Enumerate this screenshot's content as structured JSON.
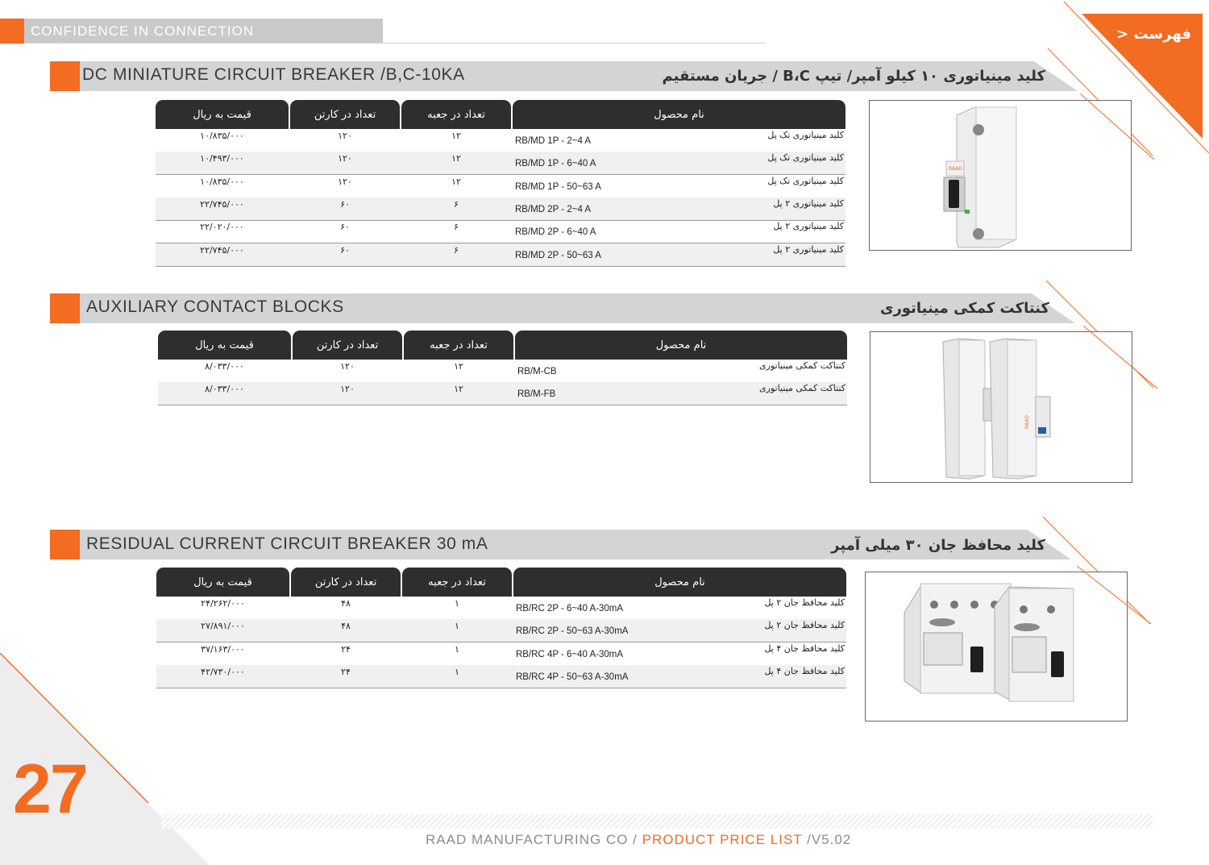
{
  "brand": {
    "tagline": "CONFIDENCE IN CONNECTION"
  },
  "menu": {
    "label": "فهرست <"
  },
  "colors": {
    "accent": "#f26c22",
    "header_dark": "#2e2e30",
    "bar_grey": "#d3d4d5"
  },
  "sections": [
    {
      "title_en": "DC MINIATURE CIRCUIT BREAKER /B,C-10KA",
      "title_fa": "کلید مینیاتوری ۱۰ کیلو آمپر/ تیپ B،C / جریان مستقیم",
      "headers": {
        "name": "نام محصول",
        "per_box": "تعداد در جعبه",
        "per_carton": "تعداد در کارتن",
        "price": "قیمت به ریال"
      },
      "rows": [
        {
          "name": "کلید مینیاتوری تک پل",
          "model": "RB/MD 1P - 2~4 A",
          "per_box": "۱۲",
          "per_carton": "۱۲۰",
          "price": "۱۰/۸۳۵/۰۰۰"
        },
        {
          "name": "کلید مینیاتوری تک پل",
          "model": "RB/MD 1P - 6~40 A",
          "per_box": "۱۲",
          "per_carton": "۱۲۰",
          "price": "۱۰/۴۹۳/۰۰۰"
        },
        {
          "name": "کلید مینیاتوری تک پل",
          "model": "RB/MD 1P - 50~63 A",
          "per_box": "۱۲",
          "per_carton": "۱۲۰",
          "price": "۱۰/۸۳۵/۰۰۰"
        },
        {
          "name": "کلید مینیاتوری ۲ پل",
          "model": "RB/MD 2P - 2~4 A",
          "per_box": "۶",
          "per_carton": "۶۰",
          "price": "۲۲/۷۴۵/۰۰۰"
        },
        {
          "name": "کلید مینیاتوری ۲ پل",
          "model": "RB/MD 2P - 6~40 A",
          "per_box": "۶",
          "per_carton": "۶۰",
          "price": "۲۲/۰۲۰/۰۰۰"
        },
        {
          "name": "کلید مینیاتوری ۲ پل",
          "model": "RB/MD 2P - 50~63 A",
          "per_box": "۶",
          "per_carton": "۶۰",
          "price": "۲۲/۷۴۵/۰۰۰"
        }
      ]
    },
    {
      "title_en": "AUXILIARY CONTACT BLOCKS",
      "title_fa": "کنتاکت کمکی مینیاتوری",
      "headers": {
        "name": "نام محصول",
        "per_box": "تعداد در جعبه",
        "per_carton": "تعداد در کارتن",
        "price": "قیمت به ریال"
      },
      "rows": [
        {
          "name": "کنتاکت کمکی مینیاتوری",
          "model": "RB/M-CB",
          "per_box": "۱۲",
          "per_carton": "۱۲۰",
          "price": "۸/۰۳۳/۰۰۰"
        },
        {
          "name": "کنتاکت کمکی مینیاتوری",
          "model": "RB/M-FB",
          "per_box": "۱۲",
          "per_carton": "۱۲۰",
          "price": "۸/۰۳۳/۰۰۰"
        }
      ]
    },
    {
      "title_en": "RESIDUAL CURRENT CIRCUIT BREAKER 30 mA",
      "title_fa": "کلید محافظ جان ۳۰ میلی آمپر",
      "headers": {
        "name": "نام محصول",
        "per_box": "تعداد در جعبه",
        "per_carton": "تعداد در کارتن",
        "price": "قیمت به ریال"
      },
      "rows": [
        {
          "name": "کلید محافظ جان ۲ پل",
          "model": "RB/RC 2P - 6~40 A-30mA",
          "per_box": "۱",
          "per_carton": "۴۸",
          "price": "۲۴/۲۶۲/۰۰۰"
        },
        {
          "name": "کلید محافظ جان ۲ پل",
          "model": "RB/RC 2P - 50~63 A-30mA",
          "per_box": "۱",
          "per_carton": "۴۸",
          "price": "۲۷/۸۹۱/۰۰۰"
        },
        {
          "name": "کلید محافظ جان ۴ پل",
          "model": "RB/RC 4P - 6~40 A-30mA",
          "per_box": "۱",
          "per_carton": "۲۴",
          "price": "۳۷/۱۶۳/۰۰۰"
        },
        {
          "name": "کلید محافظ جان ۴ پل",
          "model": "RB/RC 4P - 50~63 A-30mA",
          "per_box": "۱",
          "per_carton": "۲۴",
          "price": "۴۲/۷۳۰/۰۰۰"
        }
      ]
    }
  ],
  "footer": {
    "page_number": "27",
    "company": "RAAD MANUFACTURING CO / ",
    "doc_title": "PRODUCT PRICE LIST",
    "version": " /V5.02"
  }
}
